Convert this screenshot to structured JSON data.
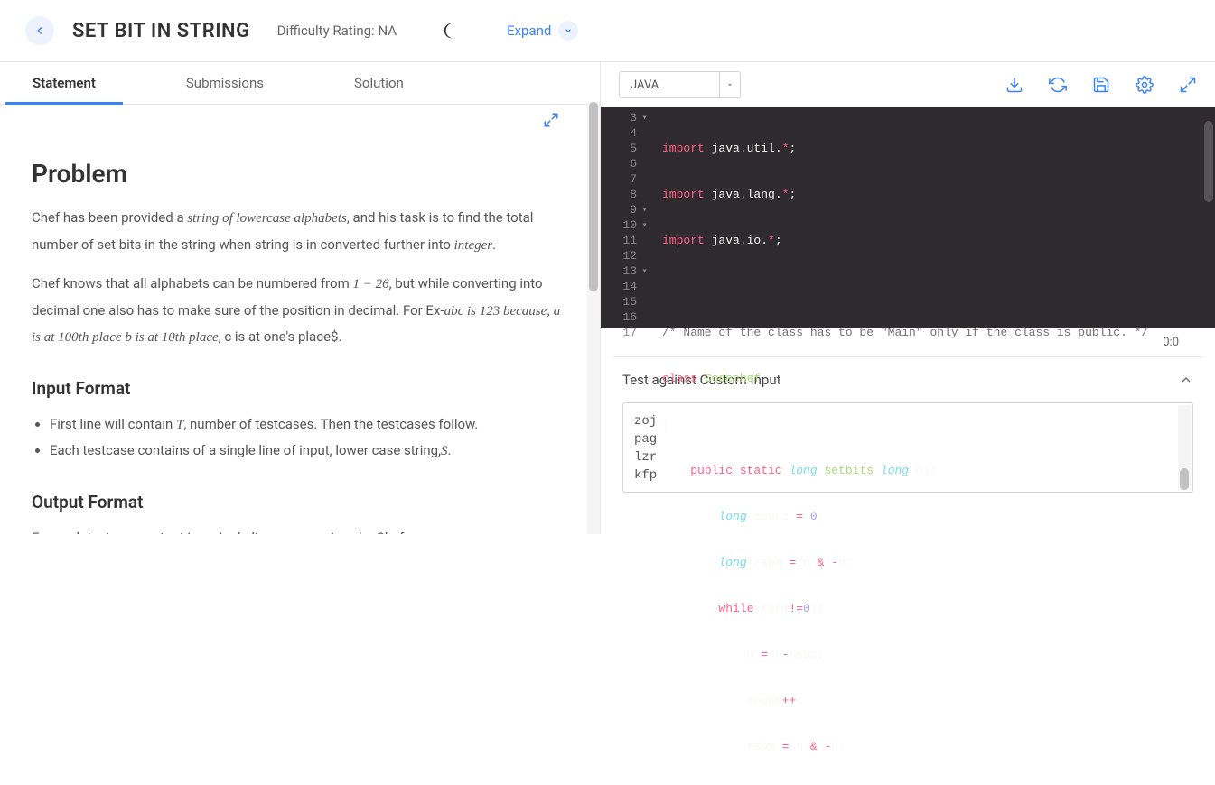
{
  "header": {
    "title": "SET BIT IN STRING",
    "difficulty_label": "Difficulty Rating:",
    "difficulty_value": "NA",
    "expand": "Expand"
  },
  "tabs": [
    "Statement",
    "Submissions",
    "Solution"
  ],
  "problem": {
    "heading": "Problem",
    "p1_a": "Chef has been provided a ",
    "p1_math1": "string of lowercase alphabets",
    "p1_b": ", and his task is to find the total number of set bits in the string when string is in converted further into ",
    "p1_math2": "integer",
    "p1_c": ".",
    "p2_a": "Chef knows that all alphabets can be numbered from ",
    "p2_math1": "1 − 26",
    "p2_b": ", but while converting into decimal one also has to make sure of the position in decimal. For Ex-",
    "p2_math2": "abc is 123 because, a is at 100th place b is at 10th place",
    "p2_c": ", c is at one's place$.",
    "input_heading": "Input Format",
    "input_li1_a": "First line will contain ",
    "input_li1_math": "T",
    "input_li1_b": ", number of testcases. Then the testcases follow.",
    "input_li2_a": "Each testcase contains of a single line of input, lower case string,",
    "input_li2_math": "S",
    "input_li2_b": ".",
    "output_heading": "Output Format",
    "output_p": "For each testcase, output in a single line answer given by Chef."
  },
  "editor": {
    "language": "JAVA",
    "lines": {
      "l3": {
        "n": "3",
        "a": "import ",
        "b": "java.util.",
        "c": "*",
        "d": ";"
      },
      "l4": {
        "n": "4",
        "a": "import ",
        "b": "java.lang.",
        "c": "*",
        "d": ";"
      },
      "l5": {
        "n": "5",
        "a": "import ",
        "b": "java.io.",
        "c": "*",
        "d": ";"
      },
      "l6": {
        "n": "6"
      },
      "l7": {
        "n": "7",
        "a": "/* Name of the class has to be \"Main\" only if the class is public. */"
      },
      "l8": {
        "n": "8",
        "a": "class ",
        "b": "Codechef"
      },
      "l9": {
        "n": "9",
        "a": "{"
      },
      "l10": {
        "n": "10",
        "a": "public ",
        "b": "static ",
        "c": "long ",
        "d": "setbits",
        "e": "(",
        "f": "long ",
        "g": "n",
        "h": "){"
      },
      "l11": {
        "n": "11",
        "a": "long ",
        "b": "count ",
        "c": "= ",
        "d": "0",
        "e": ";"
      },
      "l12": {
        "n": "12",
        "a": "long ",
        "b": "rsbm ",
        "c": "= ",
        "d": "n ",
        "e": "& ",
        "f": "-",
        "g": "n",
        "h": ";"
      },
      "l13": {
        "n": "13",
        "a": "while",
        "b": "(rsbm",
        "c": "!=",
        "d": "0",
        "e": "){"
      },
      "l14": {
        "n": "14",
        "a": "n ",
        "b": "= ",
        "c": "n",
        "d": "-",
        "e": "rsbm;"
      },
      "l15": {
        "n": "15",
        "a": "count",
        "b": "++",
        "c": ";"
      },
      "l16": {
        "n": "16",
        "a": "rsbm ",
        "b": "= ",
        "c": "n ",
        "d": "& ",
        "e": "-",
        "f": "n;"
      },
      "l17": {
        "n": "17"
      }
    },
    "cursor": "0:0"
  },
  "custom_input": {
    "header": "Test against Custom Input",
    "lines": [
      "zoj",
      "pag",
      "lzr",
      "kfp"
    ]
  }
}
